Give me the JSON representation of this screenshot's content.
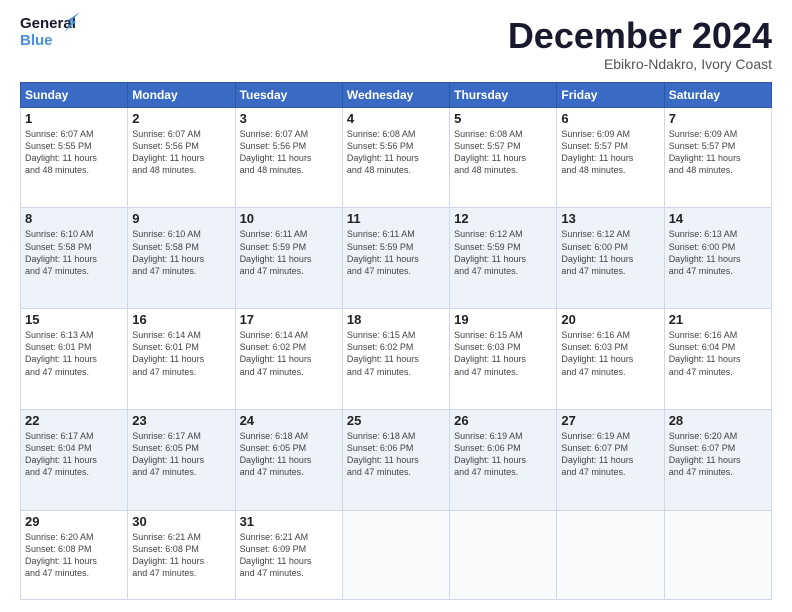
{
  "logo": {
    "line1": "General",
    "line2": "Blue"
  },
  "title": "December 2024",
  "subtitle": "Ebikro-Ndakro, Ivory Coast",
  "header_days": [
    "Sunday",
    "Monday",
    "Tuesday",
    "Wednesday",
    "Thursday",
    "Friday",
    "Saturday"
  ],
  "weeks": [
    [
      {
        "day": "1",
        "info": "Sunrise: 6:07 AM\nSunset: 5:55 PM\nDaylight: 11 hours\nand 48 minutes."
      },
      {
        "day": "2",
        "info": "Sunrise: 6:07 AM\nSunset: 5:56 PM\nDaylight: 11 hours\nand 48 minutes."
      },
      {
        "day": "3",
        "info": "Sunrise: 6:07 AM\nSunset: 5:56 PM\nDaylight: 11 hours\nand 48 minutes."
      },
      {
        "day": "4",
        "info": "Sunrise: 6:08 AM\nSunset: 5:56 PM\nDaylight: 11 hours\nand 48 minutes."
      },
      {
        "day": "5",
        "info": "Sunrise: 6:08 AM\nSunset: 5:57 PM\nDaylight: 11 hours\nand 48 minutes."
      },
      {
        "day": "6",
        "info": "Sunrise: 6:09 AM\nSunset: 5:57 PM\nDaylight: 11 hours\nand 48 minutes."
      },
      {
        "day": "7",
        "info": "Sunrise: 6:09 AM\nSunset: 5:57 PM\nDaylight: 11 hours\nand 48 minutes."
      }
    ],
    [
      {
        "day": "8",
        "info": "Sunrise: 6:10 AM\nSunset: 5:58 PM\nDaylight: 11 hours\nand 47 minutes."
      },
      {
        "day": "9",
        "info": "Sunrise: 6:10 AM\nSunset: 5:58 PM\nDaylight: 11 hours\nand 47 minutes."
      },
      {
        "day": "10",
        "info": "Sunrise: 6:11 AM\nSunset: 5:59 PM\nDaylight: 11 hours\nand 47 minutes."
      },
      {
        "day": "11",
        "info": "Sunrise: 6:11 AM\nSunset: 5:59 PM\nDaylight: 11 hours\nand 47 minutes."
      },
      {
        "day": "12",
        "info": "Sunrise: 6:12 AM\nSunset: 5:59 PM\nDaylight: 11 hours\nand 47 minutes."
      },
      {
        "day": "13",
        "info": "Sunrise: 6:12 AM\nSunset: 6:00 PM\nDaylight: 11 hours\nand 47 minutes."
      },
      {
        "day": "14",
        "info": "Sunrise: 6:13 AM\nSunset: 6:00 PM\nDaylight: 11 hours\nand 47 minutes."
      }
    ],
    [
      {
        "day": "15",
        "info": "Sunrise: 6:13 AM\nSunset: 6:01 PM\nDaylight: 11 hours\nand 47 minutes."
      },
      {
        "day": "16",
        "info": "Sunrise: 6:14 AM\nSunset: 6:01 PM\nDaylight: 11 hours\nand 47 minutes."
      },
      {
        "day": "17",
        "info": "Sunrise: 6:14 AM\nSunset: 6:02 PM\nDaylight: 11 hours\nand 47 minutes."
      },
      {
        "day": "18",
        "info": "Sunrise: 6:15 AM\nSunset: 6:02 PM\nDaylight: 11 hours\nand 47 minutes."
      },
      {
        "day": "19",
        "info": "Sunrise: 6:15 AM\nSunset: 6:03 PM\nDaylight: 11 hours\nand 47 minutes."
      },
      {
        "day": "20",
        "info": "Sunrise: 6:16 AM\nSunset: 6:03 PM\nDaylight: 11 hours\nand 47 minutes."
      },
      {
        "day": "21",
        "info": "Sunrise: 6:16 AM\nSunset: 6:04 PM\nDaylight: 11 hours\nand 47 minutes."
      }
    ],
    [
      {
        "day": "22",
        "info": "Sunrise: 6:17 AM\nSunset: 6:04 PM\nDaylight: 11 hours\nand 47 minutes."
      },
      {
        "day": "23",
        "info": "Sunrise: 6:17 AM\nSunset: 6:05 PM\nDaylight: 11 hours\nand 47 minutes."
      },
      {
        "day": "24",
        "info": "Sunrise: 6:18 AM\nSunset: 6:05 PM\nDaylight: 11 hours\nand 47 minutes."
      },
      {
        "day": "25",
        "info": "Sunrise: 6:18 AM\nSunset: 6:06 PM\nDaylight: 11 hours\nand 47 minutes."
      },
      {
        "day": "26",
        "info": "Sunrise: 6:19 AM\nSunset: 6:06 PM\nDaylight: 11 hours\nand 47 minutes."
      },
      {
        "day": "27",
        "info": "Sunrise: 6:19 AM\nSunset: 6:07 PM\nDaylight: 11 hours\nand 47 minutes."
      },
      {
        "day": "28",
        "info": "Sunrise: 6:20 AM\nSunset: 6:07 PM\nDaylight: 11 hours\nand 47 minutes."
      }
    ],
    [
      {
        "day": "29",
        "info": "Sunrise: 6:20 AM\nSunset: 6:08 PM\nDaylight: 11 hours\nand 47 minutes."
      },
      {
        "day": "30",
        "info": "Sunrise: 6:21 AM\nSunset: 6:08 PM\nDaylight: 11 hours\nand 47 minutes."
      },
      {
        "day": "31",
        "info": "Sunrise: 6:21 AM\nSunset: 6:09 PM\nDaylight: 11 hours\nand 47 minutes."
      },
      {
        "day": "",
        "info": ""
      },
      {
        "day": "",
        "info": ""
      },
      {
        "day": "",
        "info": ""
      },
      {
        "day": "",
        "info": ""
      }
    ]
  ]
}
